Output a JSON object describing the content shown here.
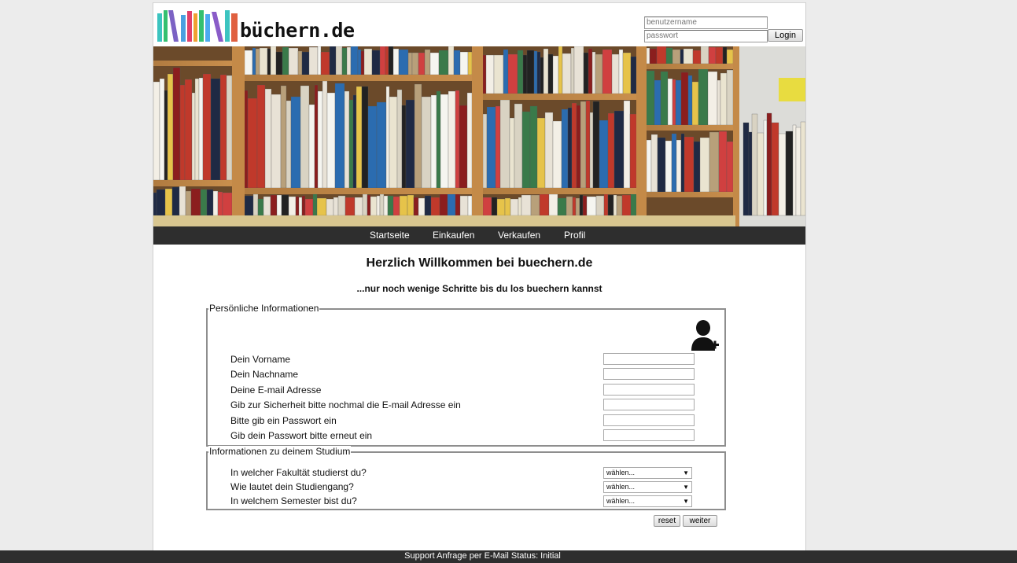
{
  "header": {
    "logo_text": "büchern.de",
    "login": {
      "username_placeholder": "benutzername",
      "password_placeholder": "passwort",
      "button_label": "Login"
    }
  },
  "nav": {
    "items": [
      {
        "label": "Startseite"
      },
      {
        "label": "Einkaufen"
      },
      {
        "label": "Verkaufen"
      },
      {
        "label": "Profil"
      }
    ]
  },
  "main": {
    "title": "Herzlich Willkommen bei buechern.de",
    "subtitle": "...nur noch wenige Schritte bis du los buechern kannst",
    "personal": {
      "legend": "Persönliche Informationen",
      "icon": "add-user-icon",
      "fields": [
        {
          "label": "Dein Vorname",
          "value": ""
        },
        {
          "label": "Dein Nachname",
          "value": ""
        },
        {
          "label": "Deine E-mail Adresse",
          "value": ""
        },
        {
          "label": "Gib zur Sicherheit bitte nochmal die E-mail Adresse ein",
          "value": ""
        },
        {
          "label": "Bitte gib ein Passwort ein",
          "value": ""
        },
        {
          "label": "Gib dein Passwort bitte erneut ein",
          "value": ""
        }
      ]
    },
    "study": {
      "legend": "Informationen zu deinem Studium",
      "fields": [
        {
          "label": "In welcher Fakultät studierst du?",
          "selected": "wählen..."
        },
        {
          "label": "Wie lautet dein Studiengang?",
          "selected": "wählen..."
        },
        {
          "label": "In welchem Semester bist du?",
          "selected": "wählen..."
        }
      ]
    },
    "buttons": {
      "reset": "reset",
      "weiter": "weiter"
    }
  },
  "footer": {
    "text": "Support Anfrage per E-Mail Status: Initial"
  },
  "colors": {
    "nav_bg": "#2e2e2e",
    "footer_bg": "#2e2e2e",
    "page_bg": "#ececec",
    "logo_books": [
      "#3cc4c0",
      "#7b62c4",
      "#4aa0e0",
      "#e0406a",
      "#34c070",
      "#f0a030",
      "#4caaf0",
      "#e06040"
    ]
  }
}
